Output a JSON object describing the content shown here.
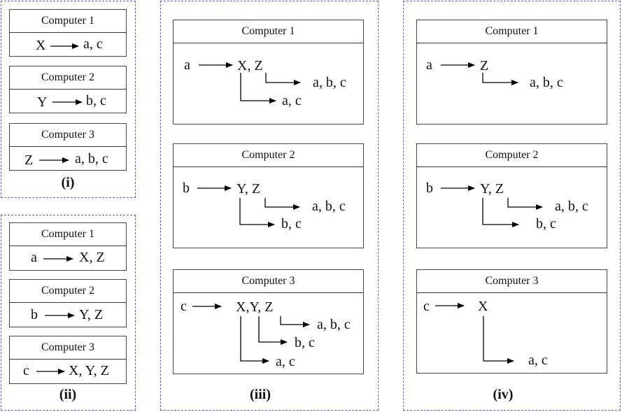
{
  "panels": {
    "i": {
      "label": "(i)",
      "computers": [
        {
          "title": "Computer 1",
          "input": "X",
          "output": "a, c"
        },
        {
          "title": "Computer 2",
          "input": "Y",
          "output": "b, c"
        },
        {
          "title": "Computer 3",
          "input": "Z",
          "output": "a, b, c"
        }
      ]
    },
    "ii": {
      "label": "(ii)",
      "computers": [
        {
          "title": "Computer 1",
          "input": "a",
          "output": "X, Z"
        },
        {
          "title": "Computer 2",
          "input": "b",
          "output": "Y, Z"
        },
        {
          "title": "Computer 3",
          "input": "c",
          "output": "X, Y, Z"
        }
      ]
    },
    "iii": {
      "label": "(iii)",
      "computers": [
        {
          "title": "Computer 1",
          "input": "a",
          "keys": "X, Z",
          "branches": [
            {
              "from": "Z",
              "output": "a, b, c"
            },
            {
              "from": "X",
              "output": "a, c"
            }
          ]
        },
        {
          "title": "Computer 2",
          "input": "b",
          "keys": "Y, Z",
          "branches": [
            {
              "from": "Z",
              "output": "a, b, c"
            },
            {
              "from": "Y",
              "output": "b, c"
            }
          ]
        },
        {
          "title": "Computer 3",
          "input": "c",
          "keys": "X,Y, Z",
          "branches": [
            {
              "from": "Z",
              "output": "a, b, c"
            },
            {
              "from": "Y",
              "output": "b, c"
            },
            {
              "from": "X",
              "output": "a, c"
            }
          ]
        }
      ]
    },
    "iv": {
      "label": "(iv)",
      "computers": [
        {
          "title": "Computer 1",
          "input": "a",
          "keys": "Z",
          "branches": [
            {
              "from": "Z",
              "output": "a, b, c"
            }
          ]
        },
        {
          "title": "Computer 2",
          "input": "b",
          "keys": "Y, Z",
          "branches": [
            {
              "from": "Z",
              "output": "a, b, c"
            },
            {
              "from": "Y",
              "output": "b, c"
            }
          ]
        },
        {
          "title": "Computer 3",
          "input": "c",
          "keys": "X",
          "branches": [
            {
              "from": "X",
              "output": "a, c"
            }
          ]
        }
      ]
    }
  },
  "colors": {
    "panel_border": "#5a5ae6",
    "box_border": "#444444",
    "text": "#111111"
  }
}
